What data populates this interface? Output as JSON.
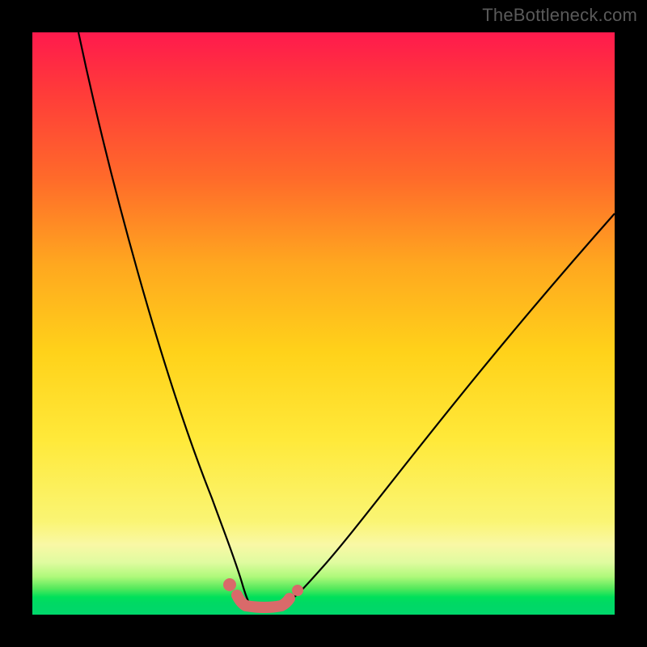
{
  "watermark": "TheBottleneck.com",
  "chart_data": {
    "type": "line",
    "title": "",
    "xlabel": "",
    "ylabel": "",
    "xlim": [
      0,
      100
    ],
    "ylim": [
      0,
      100
    ],
    "grid": false,
    "legend": false,
    "series": [
      {
        "name": "bottleneck-curve-left",
        "x": [
          8,
          12,
          16,
          20,
          24,
          28,
          31,
          33,
          34.5,
          36
        ],
        "y": [
          100,
          82,
          64,
          47,
          31,
          18,
          9,
          4.5,
          2.5,
          1.8
        ]
      },
      {
        "name": "bottleneck-curve-right",
        "x": [
          44,
          46,
          50,
          56,
          64,
          74,
          86,
          100
        ],
        "y": [
          2.3,
          3.5,
          7,
          14,
          25,
          39,
          54,
          69
        ]
      },
      {
        "name": "optimal-flat-bottom",
        "x": [
          36,
          38,
          40,
          42,
          44
        ],
        "y": [
          1.8,
          1.4,
          1.3,
          1.4,
          2.3
        ]
      }
    ],
    "annotations": [
      {
        "name": "highlight-marker-left-start",
        "x": 33.5,
        "y": 4.2
      },
      {
        "name": "highlight-marker-right-end",
        "x": 45.2,
        "y": 3.2
      },
      {
        "name": "highlight-bottom-segment",
        "x_range": [
          35,
          44
        ],
        "y": 1.5
      }
    ],
    "colors": {
      "curve": "#000000",
      "highlight": "#d96a6a",
      "gradient_top": "#ff1a4d",
      "gradient_mid": "#ffe93a",
      "gradient_bottom": "#00d76b"
    }
  }
}
